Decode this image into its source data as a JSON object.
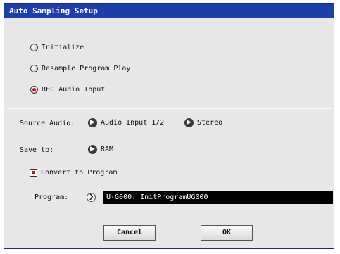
{
  "dialog": {
    "title": "Auto Sampling Setup",
    "modes": [
      {
        "label": "Initialize",
        "selected": false
      },
      {
        "label": "Resample Program Play",
        "selected": false
      },
      {
        "label": "REC Audio Input",
        "selected": true
      }
    ],
    "source_audio": {
      "label": "Source Audio:",
      "input_value": "Audio Input 1/2",
      "channel_value": "Stereo"
    },
    "save_to": {
      "label": "Save to:",
      "value": "RAM"
    },
    "convert": {
      "label": "Convert to Program",
      "checked": true
    },
    "program": {
      "label": "Program:",
      "value": "U-G000: InitProgramUG000"
    },
    "buttons": {
      "cancel": "Cancel",
      "ok": "OK"
    },
    "colors": {
      "title_bar": "#1f3fa8",
      "selected_indicator": "#c4141a",
      "program_field_bg": "#000000"
    }
  }
}
